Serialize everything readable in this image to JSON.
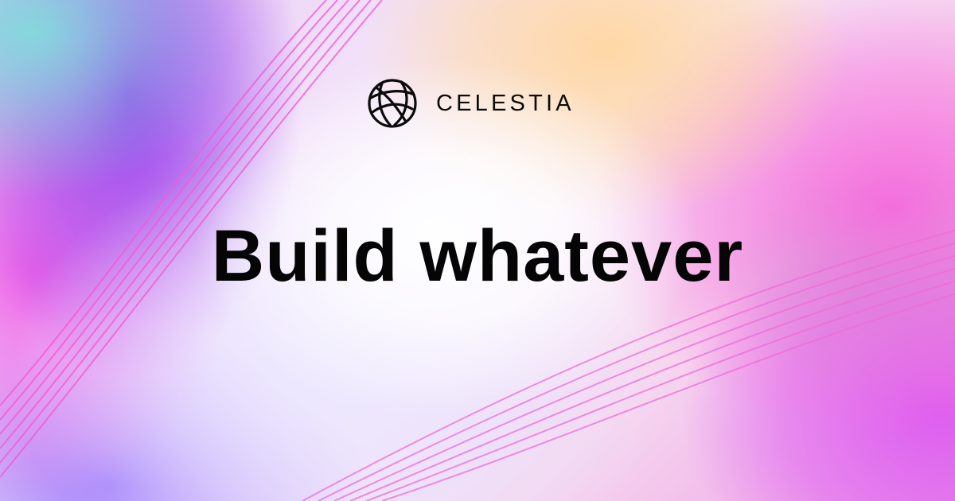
{
  "brand": {
    "name": "CELESTIA",
    "logo_icon": "globe-orbit-icon"
  },
  "headline": {
    "text": "Build whatever"
  },
  "colors": {
    "text": "#050505",
    "accent_pink": "#f05ad2",
    "accent_purple": "#9137eb",
    "accent_peach": "#ffd6a0",
    "accent_teal": "#82dcdc"
  }
}
